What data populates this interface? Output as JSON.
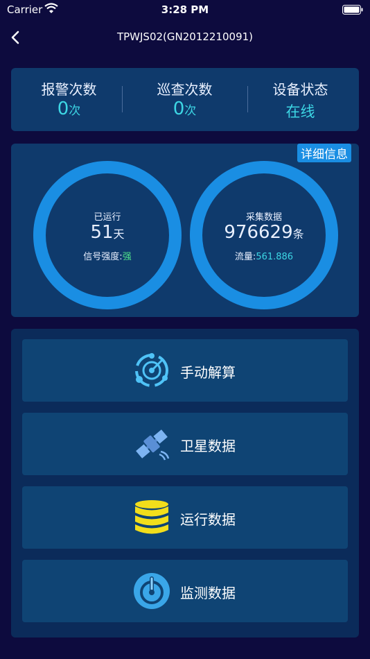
{
  "status_bar": {
    "carrier": "Carrier",
    "time": "3:28 PM"
  },
  "nav": {
    "title": "TPWJS02(GN2012210091)"
  },
  "stats": {
    "alarm_label": "报警次数",
    "alarm_value": "0",
    "alarm_unit": "次",
    "patrol_label": "巡查次数",
    "patrol_value": "0",
    "patrol_unit": "次",
    "status_label": "设备状态",
    "status_value": "在线"
  },
  "rings": {
    "detail_label": "详细信息",
    "run": {
      "caption": "已运行",
      "value": "51",
      "unit": "天",
      "sub_label": "信号强度:",
      "sub_value": "强"
    },
    "collect": {
      "caption": "采集数据",
      "value": "976629",
      "unit": "条",
      "sub_label": "流量:",
      "sub_value": "561.886"
    }
  },
  "actions": [
    {
      "label": "手动解算",
      "icon": "manual-calc-icon"
    },
    {
      "label": "卫星数据",
      "icon": "satellite-icon"
    },
    {
      "label": "运行数据",
      "icon": "database-icon"
    },
    {
      "label": "监测数据",
      "icon": "monitor-gauge-icon"
    }
  ],
  "colors": {
    "accent": "#1a8ee3",
    "value": "#3dd6e4",
    "good": "#4fe08a",
    "db_yellow": "#f2de1b"
  }
}
